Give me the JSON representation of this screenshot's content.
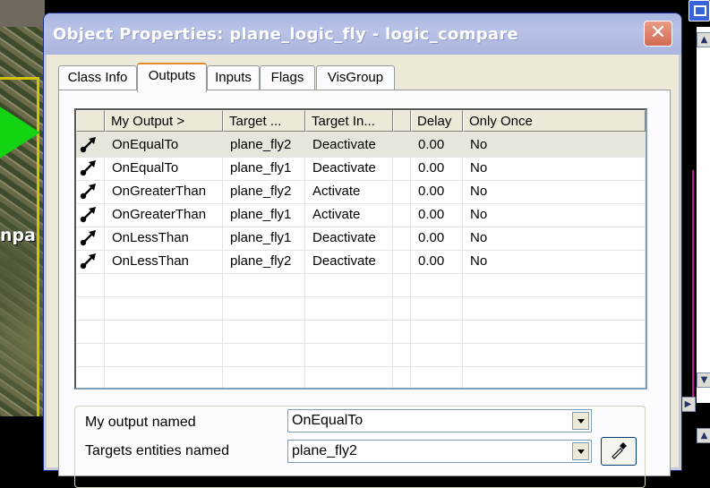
{
  "window": {
    "title": "Object Properties: plane_logic_fly - logic_compare",
    "close_glyph": "✕"
  },
  "background": {
    "entity_label": "npa"
  },
  "tabs": [
    {
      "label": "Class Info",
      "active": false
    },
    {
      "label": "Outputs",
      "active": true
    },
    {
      "label": "Inputs",
      "active": false
    },
    {
      "label": "Flags",
      "active": false
    },
    {
      "label": "VisGroup",
      "active": false
    }
  ],
  "grid": {
    "columns": [
      "",
      "My Output >",
      "Target ...",
      "Target In...",
      "",
      "Delay",
      "Only Once"
    ],
    "rows": [
      {
        "output": "OnEqualTo",
        "target": "plane_fly2",
        "input": "Deactivate",
        "delay": "0.00",
        "once": "No"
      },
      {
        "output": "OnEqualTo",
        "target": "plane_fly1",
        "input": "Deactivate",
        "delay": "0.00",
        "once": "No"
      },
      {
        "output": "OnGreaterThan",
        "target": "plane_fly2",
        "input": "Activate",
        "delay": "0.00",
        "once": "No"
      },
      {
        "output": "OnGreaterThan",
        "target": "plane_fly1",
        "input": "Activate",
        "delay": "0.00",
        "once": "No"
      },
      {
        "output": "OnLessThan",
        "target": "plane_fly1",
        "input": "Deactivate",
        "delay": "0.00",
        "once": "No"
      },
      {
        "output": "OnLessThan",
        "target": "plane_fly2",
        "input": "Deactivate",
        "delay": "0.00",
        "once": "No"
      }
    ],
    "icon": "connection-icon"
  },
  "details": {
    "output_label": "My output named",
    "output_value": "OnEqualTo",
    "targets_label": "Targets entities named",
    "targets_value": "plane_fly2",
    "pick_icon": "eyedropper-icon"
  },
  "colors": {
    "title_bar": "#aab5df",
    "tab_active_accent": "#e68b2c",
    "selected_row": "#e8e6dc"
  }
}
